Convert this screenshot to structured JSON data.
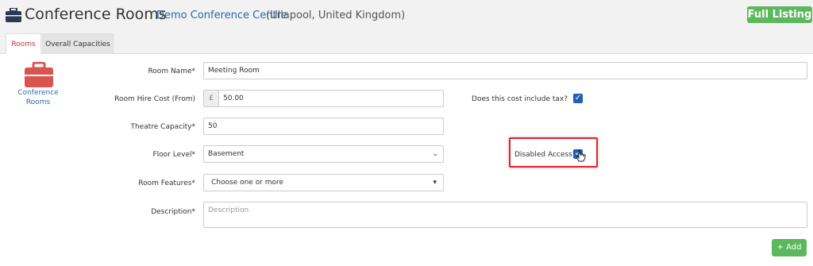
{
  "header": {
    "title": "Conference Rooms",
    "venue_name": "Demo Conference Centre",
    "venue_location": "(Ullapool, United Kingdom)",
    "full_listing_label": "Full Listing"
  },
  "tabs": [
    {
      "label": "Rooms",
      "active": true
    },
    {
      "label": "Overall Capacities",
      "active": false
    }
  ],
  "sidebar": {
    "label": "Conference Rooms"
  },
  "form": {
    "room_name": {
      "label": "Room Name",
      "required": "*",
      "value": "Meeting Room"
    },
    "hire_cost": {
      "label": "Room Hire Cost (From)",
      "currency": "£",
      "value": "50.00"
    },
    "include_tax": {
      "label": "Does this cost include tax?",
      "checked": true
    },
    "theatre_capacity": {
      "label": "Theatre Capacity",
      "required": "*",
      "value": "50"
    },
    "floor_level": {
      "label": "Floor Level",
      "required": "*",
      "value": "Basement"
    },
    "disabled_access": {
      "label": "Disabled Access?",
      "checked": true
    },
    "room_features": {
      "label": "Room Features",
      "required": "*",
      "placeholder": "Choose one or more"
    },
    "description": {
      "label": "Description",
      "required": "*",
      "placeholder": "Description"
    },
    "add_label": "Add"
  },
  "colors": {
    "accent": "#5cb85c",
    "active_tab": "#c9302c",
    "link": "#2a6aa8",
    "highlight": "#d9262e"
  }
}
